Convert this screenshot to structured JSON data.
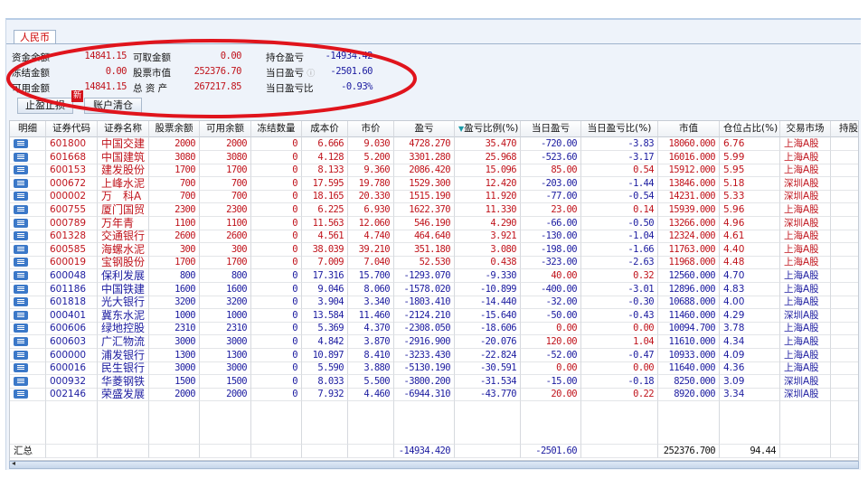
{
  "tab": "人民币",
  "summary": {
    "items": [
      {
        "label": "资金余额",
        "value": "14841.15",
        "color": "red"
      },
      {
        "label": "冻结金额",
        "value": "0.00",
        "color": "red"
      },
      {
        "label": "可用金额",
        "value": "14841.15",
        "color": "red"
      },
      {
        "label": "可取金额",
        "value": "0.00",
        "color": "red"
      },
      {
        "label": "股票市值",
        "value": "252376.70",
        "color": "red"
      },
      {
        "label": "总 资 产",
        "value": "267217.85",
        "color": "red"
      },
      {
        "label": "持仓盈亏",
        "value": "-14934.42",
        "color": "blue"
      },
      {
        "label": "当日盈亏",
        "value": "-2501.60",
        "color": "blue"
      },
      {
        "label": "当日盈亏比",
        "value": "-0.93%",
        "color": "blue"
      }
    ],
    "info_icon": "info-circle-icon"
  },
  "buttons": {
    "stop": "止盈止损",
    "new_badge": "新",
    "clear": "账户清仓"
  },
  "annotation_color": "#e0141c",
  "colors": {
    "gain": "#c0141c",
    "loss": "#1c1ca0"
  },
  "table": {
    "headers": [
      "明细",
      "证券代码",
      "证券名称",
      "股票余额",
      "可用余额",
      "冻结数量",
      "成本价",
      "市价",
      "盈亏",
      "盈亏比例(%)",
      "当日盈亏",
      "当日盈亏比(%)",
      "市值",
      "仓位占比(%)",
      "交易市场",
      "持股"
    ],
    "sort_indicator": "▼",
    "rows": [
      [
        "601800",
        "中国交建",
        "2000",
        "2000",
        "0",
        "6.666",
        "9.030",
        "4728.270",
        "35.470",
        "-720.00",
        "-3.83",
        "18060.000",
        "6.76",
        "上海A股"
      ],
      [
        "601668",
        "中国建筑",
        "3080",
        "3080",
        "0",
        "4.128",
        "5.200",
        "3301.280",
        "25.968",
        "-523.60",
        "-3.17",
        "16016.000",
        "5.99",
        "上海A股"
      ],
      [
        "600153",
        "建发股份",
        "1700",
        "1700",
        "0",
        "8.133",
        "9.360",
        "2086.420",
        "15.096",
        "85.00",
        "0.54",
        "15912.000",
        "5.95",
        "上海A股"
      ],
      [
        "000672",
        "上峰水泥",
        "700",
        "700",
        "0",
        "17.595",
        "19.780",
        "1529.300",
        "12.420",
        "-203.00",
        "-1.44",
        "13846.000",
        "5.18",
        "深圳A股"
      ],
      [
        "000002",
        "万　科A",
        "700",
        "700",
        "0",
        "18.165",
        "20.330",
        "1515.190",
        "11.920",
        "-77.00",
        "-0.54",
        "14231.000",
        "5.33",
        "深圳A股"
      ],
      [
        "600755",
        "厦门国贸",
        "2300",
        "2300",
        "0",
        "6.225",
        "6.930",
        "1622.370",
        "11.330",
        "23.00",
        "0.14",
        "15939.000",
        "5.96",
        "上海A股"
      ],
      [
        "000789",
        "万年青",
        "1100",
        "1100",
        "0",
        "11.563",
        "12.060",
        "546.190",
        "4.290",
        "-66.00",
        "-0.50",
        "13266.000",
        "4.96",
        "深圳A股"
      ],
      [
        "601328",
        "交通银行",
        "2600",
        "2600",
        "0",
        "4.561",
        "4.740",
        "464.640",
        "3.921",
        "-130.00",
        "-1.04",
        "12324.000",
        "4.61",
        "上海A股"
      ],
      [
        "600585",
        "海螺水泥",
        "300",
        "300",
        "0",
        "38.039",
        "39.210",
        "351.180",
        "3.080",
        "-198.00",
        "-1.66",
        "11763.000",
        "4.40",
        "上海A股"
      ],
      [
        "600019",
        "宝钢股份",
        "1700",
        "1700",
        "0",
        "7.009",
        "7.040",
        "52.530",
        "0.438",
        "-323.00",
        "-2.63",
        "11968.000",
        "4.48",
        "上海A股"
      ],
      [
        "600048",
        "保利发展",
        "800",
        "800",
        "0",
        "17.316",
        "15.700",
        "-1293.070",
        "-9.330",
        "40.00",
        "0.32",
        "12560.000",
        "4.70",
        "上海A股"
      ],
      [
        "601186",
        "中国铁建",
        "1600",
        "1600",
        "0",
        "9.046",
        "8.060",
        "-1578.020",
        "-10.899",
        "-400.00",
        "-3.01",
        "12896.000",
        "4.83",
        "上海A股"
      ],
      [
        "601818",
        "光大银行",
        "3200",
        "3200",
        "0",
        "3.904",
        "3.340",
        "-1803.410",
        "-14.440",
        "-32.00",
        "-0.30",
        "10688.000",
        "4.00",
        "上海A股"
      ],
      [
        "000401",
        "冀东水泥",
        "1000",
        "1000",
        "0",
        "13.584",
        "11.460",
        "-2124.210",
        "-15.640",
        "-50.00",
        "-0.43",
        "11460.000",
        "4.29",
        "深圳A股"
      ],
      [
        "600606",
        "绿地控股",
        "2310",
        "2310",
        "0",
        "5.369",
        "4.370",
        "-2308.050",
        "-18.606",
        "0.00",
        "0.00",
        "10094.700",
        "3.78",
        "上海A股"
      ],
      [
        "600603",
        "广汇物流",
        "3000",
        "3000",
        "0",
        "4.842",
        "3.870",
        "-2916.900",
        "-20.076",
        "120.00",
        "1.04",
        "11610.000",
        "4.34",
        "上海A股"
      ],
      [
        "600000",
        "浦发银行",
        "1300",
        "1300",
        "0",
        "10.897",
        "8.410",
        "-3233.430",
        "-22.824",
        "-52.00",
        "-0.47",
        "10933.000",
        "4.09",
        "上海A股"
      ],
      [
        "600016",
        "民生银行",
        "3000",
        "3000",
        "0",
        "5.590",
        "3.880",
        "-5130.190",
        "-30.591",
        "0.00",
        "0.00",
        "11640.000",
        "4.36",
        "上海A股"
      ],
      [
        "000932",
        "华菱钢铁",
        "1500",
        "1500",
        "0",
        "8.033",
        "5.500",
        "-3800.200",
        "-31.534",
        "-15.00",
        "-0.18",
        "8250.000",
        "3.09",
        "深圳A股"
      ],
      [
        "002146",
        "荣盛发展",
        "2000",
        "2000",
        "0",
        "7.932",
        "4.460",
        "-6944.310",
        "-43.770",
        "20.00",
        "0.22",
        "8920.000",
        "3.34",
        "深圳A股"
      ]
    ],
    "total": {
      "label": "汇总",
      "pnl": "-14934.420",
      "day_pnl": "-2501.60",
      "market_value": "252376.700",
      "position_pct": "94.44"
    }
  }
}
